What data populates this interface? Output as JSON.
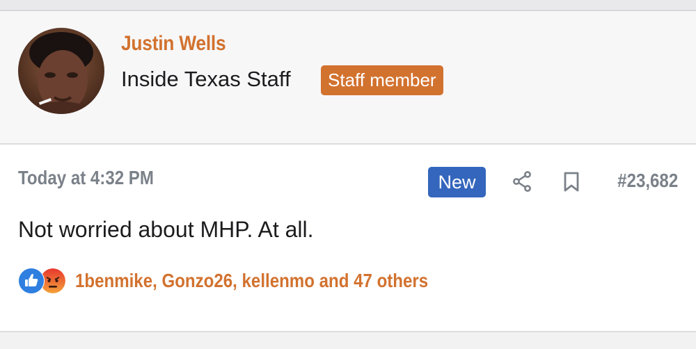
{
  "author": {
    "name": "Justin Wells",
    "title": "Inside Texas Staff",
    "badge": "Staff member"
  },
  "post": {
    "time": "Today at 4:32 PM",
    "new_badge": "New",
    "number": "#23,682",
    "text": "Not worried about MHP. At all.",
    "reactions_text": "1benmike, Gonzo26, kellenmo and 47 others"
  },
  "icons": {
    "share": "share-icon",
    "bookmark": "bookmark-icon",
    "like_reaction": "like-icon",
    "angry_reaction": "angry-icon"
  },
  "colors": {
    "accent": "#d2722f",
    "new_badge": "#3466bd",
    "muted_text": "#7b8189"
  }
}
